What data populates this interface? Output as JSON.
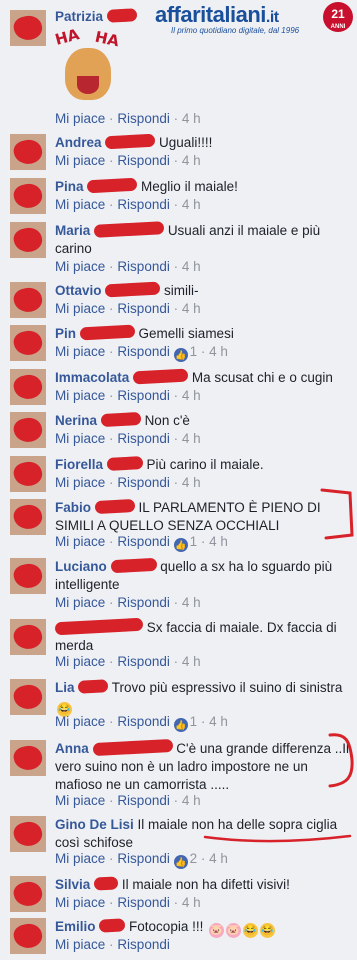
{
  "logo": {
    "brand": "affaritaliani",
    "tld": ".it",
    "tagline": "Il primo quotidiano digitale, dal 1996",
    "badge": "21",
    "badge_sub": "ANNI"
  },
  "actions": {
    "like": "Mi piace",
    "reply": "Rispondi",
    "sep": "·"
  },
  "comments": [
    {
      "author": "Patrizia",
      "text": "",
      "likes": "",
      "time": "4 h",
      "sticker": "HA HA"
    },
    {
      "author": "Andrea",
      "text": "Uguali!!!!",
      "likes": "",
      "time": "4 h"
    },
    {
      "author": "Pina",
      "text": "Meglio il maiale!",
      "likes": "",
      "time": "4 h"
    },
    {
      "author": "Maria",
      "text": "Usuali anzi il maiale e più carino",
      "likes": "",
      "time": "4 h"
    },
    {
      "author": "Ottavio",
      "text": "simili-",
      "likes": "",
      "time": "4 h"
    },
    {
      "author": "Pin",
      "text": "Gemelli siamesi",
      "likes": "1",
      "time": "4 h"
    },
    {
      "author": "Immacolata",
      "text": "Ma scusat chi e o cugin",
      "likes": "",
      "time": "4 h"
    },
    {
      "author": "Nerina",
      "text": "Non c'è",
      "likes": "",
      "time": "4 h"
    },
    {
      "author": "Fiorella",
      "text": "Più carino il maiale.",
      "likes": "",
      "time": "4 h"
    },
    {
      "author": "Fabio",
      "text": "IL PARLAMENTO È PIENO DI SIMILI A QUELLO SENZA OCCHIALI",
      "likes": "1",
      "time": "4 h"
    },
    {
      "author": "Luciano",
      "text": "quello a sx ha lo sguardo più intelligente",
      "likes": "",
      "time": "4 h"
    },
    {
      "author": "",
      "text": "Sx faccia di maiale. Dx faccia di merda",
      "likes": "",
      "time": "4 h"
    },
    {
      "author": "Lia",
      "text": "Trovo più espressivo il suino di sinistra",
      "likes": "1",
      "time": "4 h"
    },
    {
      "author": "Anna",
      "text": "C'è una grande differenza ..Il vero suino non è un ladro impostore ne un mafioso ne un camorrista .....",
      "likes": "",
      "time": "4 h"
    },
    {
      "author": "Gino De Lisi",
      "text": "Il maiale non ha delle sopra ciglia così schifose",
      "likes": "2",
      "time": "4 h"
    },
    {
      "author": "Silvia",
      "text": "Il maiale non ha difetti visivi!",
      "likes": "",
      "time": "4 h"
    },
    {
      "author": "Emilio",
      "text": "Fotocopia !!!",
      "likes": "",
      "time": ""
    }
  ],
  "colors": {
    "link": "#365899",
    "scribble": "#d7222a",
    "like_badge": "#4267b2"
  }
}
